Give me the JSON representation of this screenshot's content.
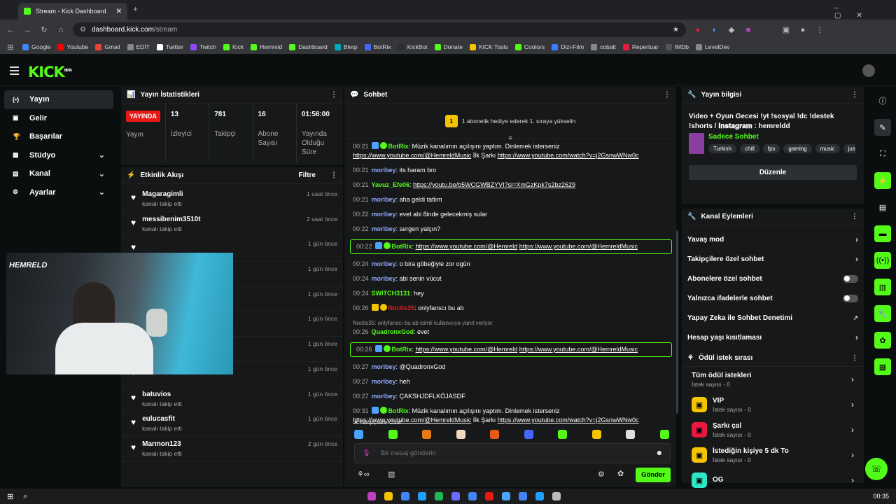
{
  "browser": {
    "tab_title": "Stream - Kick Dashboard",
    "url_host": "dashboard.kick.com",
    "url_path": "/stream",
    "bookmarks": [
      "Google",
      "Youtube",
      "Gmail",
      "EDİT",
      "Twitter",
      "Twitch",
      "Kick",
      "Hemreld",
      "Dashboard",
      "Blerp",
      "BotRix",
      "KickBot",
      "Donate",
      "KICK Tools",
      "Coolors",
      "Dizi-Film",
      "cobalt",
      "Repertuar",
      "IMDb",
      "LevelDev"
    ]
  },
  "app": {
    "logo": "KICK",
    "logo_beta": "BETA"
  },
  "nav": [
    {
      "label": "Yayın",
      "icon": "(•)",
      "chev": ""
    },
    {
      "label": "Gelir",
      "icon": "▣",
      "chev": ""
    },
    {
      "label": "Başarılar",
      "icon": "🏆",
      "chev": ""
    },
    {
      "label": "Stüdyo",
      "icon": "▦",
      "chev": "⌄"
    },
    {
      "label": "Kanal",
      "icon": "▤",
      "chev": "⌄"
    },
    {
      "label": "Ayarlar",
      "icon": "⚙",
      "chev": "⌄"
    }
  ],
  "stats_panel": {
    "title": "Yayın İstatistikleri",
    "live_badge": "YAYINDA",
    "live_label": "Yayın",
    "stats": [
      {
        "value": "13",
        "label": "İzleyici"
      },
      {
        "value": "781",
        "label": "Takipçi"
      },
      {
        "value": "16",
        "label": "Abone Sayısı"
      },
      {
        "value": "01:56:00",
        "label": "Yayında Olduğu Süre"
      }
    ]
  },
  "activity": {
    "title": "Etkinlik Akışı",
    "filter": "Filtre",
    "events": [
      {
        "name": "Magaragimli",
        "sub": "kanalı takip etti",
        "time": "1 saat önce"
      },
      {
        "name": "messibenim3510t",
        "sub": "kanalı takip etti",
        "time": "2 saat önce"
      },
      {
        "name": "",
        "sub": "",
        "time": "1 gün önce"
      },
      {
        "name": "",
        "sub": "",
        "time": "1 gün önce"
      },
      {
        "name": "",
        "sub": "",
        "time": "1 gün önce"
      },
      {
        "name": "",
        "sub": "",
        "time": "1 gün önce"
      },
      {
        "name": "",
        "sub": "",
        "time": "1 gün önce"
      },
      {
        "name": "",
        "sub": "kanalı takip etti",
        "time": "1 gün önce"
      },
      {
        "name": "batuvios",
        "sub": "kanalı takip etti",
        "time": "1 gün önce"
      },
      {
        "name": "eulucasfit",
        "sub": "kanalı takip etti",
        "time": "1 gün önce"
      },
      {
        "name": "Marmon123",
        "sub": "kanalı takip etti",
        "time": "2 gün önce"
      }
    ]
  },
  "chat": {
    "title": "Sohbet",
    "pinned": "1 abonelik hediye ederek 1. sıraya yükselin",
    "pinned_num": "1",
    "messages": [
      {
        "ts": "00:21",
        "user": "BotRix",
        "color": "#53fc18",
        "text": " Müzik kanalımın açılışını yaptım. Dinlemek isterseniz ",
        "links": [
          "https://www.youtube.com/@HemreldMusic"
        ],
        "mid": " İlk Şarkı ",
        "links2": [
          "https://www.youtube.com/watch?v=j2GsnwWNw0c"
        ],
        "hl": false,
        "bot": true
      },
      {
        "ts": "00:21",
        "user": "moribey",
        "color": "#8fa8ff",
        "text": " its haram bro"
      },
      {
        "ts": "00:21",
        "user": "Yavuz_Efe06",
        "color": "#53fc18",
        "text": " ",
        "links": [
          "https://youtu.be/b5WCGWBZYVI?si=XmGzKpk7s2bz2629"
        ]
      },
      {
        "ts": "00:21",
        "user": "moribey",
        "color": "#8fa8ff",
        "text": " aha geldi tatlım"
      },
      {
        "ts": "00:22",
        "user": "moribey",
        "color": "#8fa8ff",
        "text": " evet abi 8inde gelecekmiş sular"
      },
      {
        "ts": "00:22",
        "user": "moribey",
        "color": "#8fa8ff",
        "text": " sergen yalçın?"
      },
      {
        "ts": "00:22",
        "user": "BotRix",
        "color": "#53fc18",
        "text": " ",
        "links": [
          "https://www.youtube.com/@Hemreld",
          "https://www.youtube.com/@HemreldMusic"
        ],
        "hl": true,
        "bot": true
      },
      {
        "ts": "00:24",
        "user": "moribey",
        "color": "#8fa8ff",
        "text": " o bira göbeğiyle zor ogün"
      },
      {
        "ts": "00:24",
        "user": "moribey",
        "color": "#8fa8ff",
        "text": " abi senin vücut"
      },
      {
        "ts": "00:24",
        "user": "SWITCH3131",
        "color": "#53fc18",
        "text": " hey"
      },
      {
        "ts": "00:26",
        "user": "Noctis35",
        "color": "#e91916",
        "text": " onlyfanscı bu ab",
        "badges": true
      },
      {
        "ts": "00:26",
        "user": "QuadronxGod",
        "color": "#53fc18",
        "text": " evet",
        "reply": "Noctis35: onlyfanscı bu ab isimli kullanıcıya yanıt veriyor"
      },
      {
        "ts": "00:26",
        "user": "BotRix",
        "color": "#53fc18",
        "text": " ",
        "links": [
          "https://www.youtube.com/@Hemreld",
          "https://www.youtube.com/@HemreldMusic"
        ],
        "hl": true,
        "bot": true
      },
      {
        "ts": "00:27",
        "user": "moribey",
        "color": "#8fa8ff",
        "text": " @QuadronxGod"
      },
      {
        "ts": "00:27",
        "user": "moribey",
        "color": "#8fa8ff",
        "text": " heh"
      },
      {
        "ts": "00:27",
        "user": "moribey",
        "color": "#8fa8ff",
        "text": " ÇAKSHJDFLKÖJASDF"
      },
      {
        "ts": "00:31",
        "user": "BotRix",
        "color": "#53fc18",
        "text": " Müzik kanalımın açılışını yaptım. Dinlemek isterseniz ",
        "links": [
          "https://www.youtube.com/@HemreldMusic"
        ],
        "mid": " İlk Şarkı ",
        "links2": [
          "https://www.youtube.com/watch?v=j2GsnwWNw0c"
        ],
        "bot": true
      }
    ],
    "followers_only": "Takipçilere Özel",
    "placeholder": "Bir mesaj gönderin",
    "send": "Gönder"
  },
  "info": {
    "title": "Yayın bilgisi",
    "stream_title": "Video + Oyun Gecesi !yt !sosyal !dc !destek !shorts / 𝐈𝐧𝐬𝐭𝐚𝐠𝐫𝐚𝐦 : hemreldd",
    "category": "Sadece Sohbet",
    "tags": [
      "Turkish",
      "chill",
      "fps",
      "gaming",
      "music",
      "justc"
    ],
    "edit": "Düzenle"
  },
  "channel_actions": {
    "title": "Kanal Eylemleri",
    "items": [
      {
        "label": "Yavaş mod",
        "kind": "arrow"
      },
      {
        "label": "Takipçilere özel sohbet",
        "kind": "arrow"
      },
      {
        "label": "Abonelere özel sohbet",
        "kind": "toggle"
      },
      {
        "label": "Yalnızca ifadelerle sohbet",
        "kind": "toggle"
      },
      {
        "label": "Yapay Zeka ile Sohbet Denetimi",
        "kind": "ext"
      },
      {
        "label": "Hesap yaşı kısıtlaması",
        "kind": "arrow"
      }
    ]
  },
  "rewards": {
    "title": "Ödül istek sırası",
    "items": [
      {
        "name": "Tüm ödül istekleri",
        "count": "İstek sayısı - 0",
        "color": ""
      },
      {
        "name": "VIP",
        "count": "İstek sayısı - 0",
        "color": "#f5c400"
      },
      {
        "name": "Şarkı çal",
        "count": "İstek sayısı - 0",
        "color": "#e91940"
      },
      {
        "name": "İstediğin kişiye 5 dk To",
        "count": "İstek sayısı - 0",
        "color": "#f5c400"
      },
      {
        "name": "OG",
        "count": "",
        "color": "#2ee6c4"
      }
    ]
  },
  "taskbar": {
    "time": "00:35"
  }
}
